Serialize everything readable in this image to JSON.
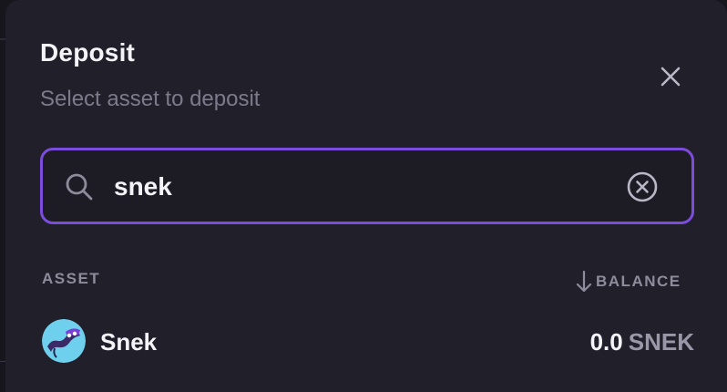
{
  "modal": {
    "title": "Deposit",
    "subtitle": "Select asset to deposit",
    "close_icon": "close-icon"
  },
  "search": {
    "value": "snek",
    "icon": "search-icon",
    "clear_icon": "clear-circle-icon"
  },
  "table": {
    "headers": {
      "asset": "ASSET",
      "balance": "BALANCE",
      "sort_icon": "arrow-down-icon"
    },
    "rows": [
      {
        "name": "Snek",
        "amount": "0.0",
        "ticker": "SNEK",
        "icon": "snek-token-icon"
      }
    ]
  },
  "colors": {
    "accent": "#7c4ddc",
    "modal_bg": "#211f29",
    "text_primary": "#f4f3f7",
    "text_muted": "#7d7a8c"
  }
}
